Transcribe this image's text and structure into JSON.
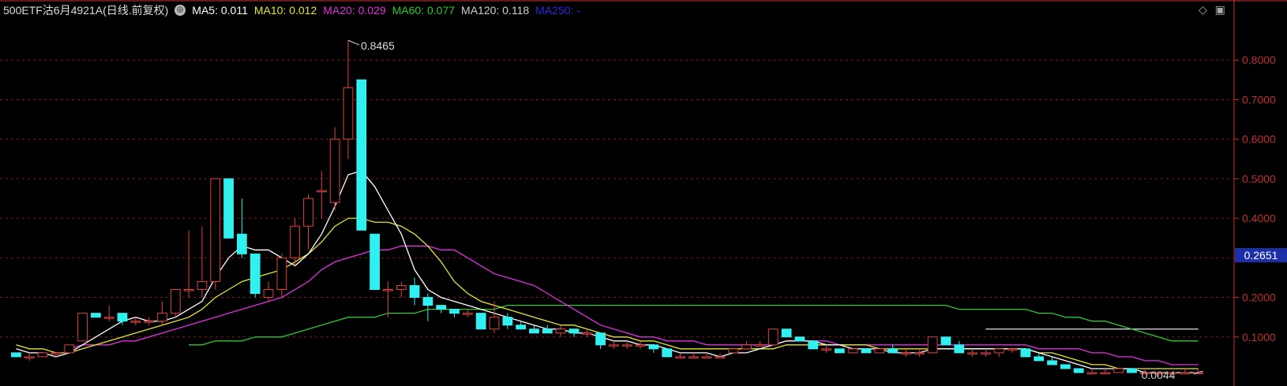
{
  "legend": {
    "title": "500ETF沽6月4921A(日线.前复权)",
    "indicators": [
      {
        "name": "MA5: 0.011",
        "color": "#ffffff"
      },
      {
        "name": "MA10: 0.012",
        "color": "#e8e82a"
      },
      {
        "name": "MA20: 0.029",
        "color": "#e030e0"
      },
      {
        "name": "MA60: 0.077",
        "color": "#2ec82e"
      },
      {
        "name": "MA120: 0.118",
        "color": "#d0d0d0"
      },
      {
        "name": "MA250: -",
        "color": "#2a2adf"
      }
    ]
  },
  "price_badge": "0.2651",
  "chart_data": {
    "type": "candlestick",
    "y_axis": {
      "min": 0,
      "max": 0.9,
      "ticks": [
        "0.8000",
        "0.7000",
        "0.6000",
        "0.5000",
        "0.4000",
        "0.3000",
        "0.2000",
        "0.1000"
      ],
      "values": [
        0.8,
        0.7,
        0.6,
        0.5,
        0.4,
        0.3,
        0.2,
        0.1
      ]
    },
    "annotations": {
      "high": "0.8465",
      "low": "0.0044"
    },
    "grid": true,
    "colors": {
      "up": "#e04040",
      "down": "#30f0f0",
      "axis": "#c03030"
    },
    "candles": [
      [
        0.06,
        0.06,
        0.05,
        0.05
      ],
      [
        0.05,
        0.06,
        0.04,
        0.05
      ],
      [
        0.05,
        0.06,
        0.05,
        0.06
      ],
      [
        0.06,
        0.06,
        0.05,
        0.06
      ],
      [
        0.06,
        0.08,
        0.06,
        0.08
      ],
      [
        0.09,
        0.16,
        0.09,
        0.16
      ],
      [
        0.16,
        0.16,
        0.15,
        0.15
      ],
      [
        0.15,
        0.18,
        0.14,
        0.15
      ],
      [
        0.16,
        0.16,
        0.13,
        0.14
      ],
      [
        0.14,
        0.15,
        0.13,
        0.14
      ],
      [
        0.14,
        0.15,
        0.13,
        0.14
      ],
      [
        0.14,
        0.19,
        0.13,
        0.16
      ],
      [
        0.16,
        0.22,
        0.15,
        0.22
      ],
      [
        0.22,
        0.37,
        0.2,
        0.22
      ],
      [
        0.22,
        0.38,
        0.2,
        0.24
      ],
      [
        0.24,
        0.5,
        0.22,
        0.5
      ],
      [
        0.5,
        0.5,
        0.35,
        0.35
      ],
      [
        0.36,
        0.45,
        0.3,
        0.31
      ],
      [
        0.31,
        0.3,
        0.2,
        0.21
      ],
      [
        0.2,
        0.24,
        0.19,
        0.22
      ],
      [
        0.22,
        0.31,
        0.2,
        0.3
      ],
      [
        0.3,
        0.4,
        0.28,
        0.38
      ],
      [
        0.38,
        0.46,
        0.32,
        0.45
      ],
      [
        0.47,
        0.52,
        0.4,
        0.47
      ],
      [
        0.44,
        0.63,
        0.42,
        0.6
      ],
      [
        0.6,
        0.85,
        0.55,
        0.73
      ],
      [
        0.75,
        0.75,
        0.37,
        0.37
      ],
      [
        0.36,
        0.36,
        0.22,
        0.22
      ],
      [
        0.22,
        0.24,
        0.15,
        0.22
      ],
      [
        0.22,
        0.24,
        0.2,
        0.23
      ],
      [
        0.23,
        0.25,
        0.18,
        0.2
      ],
      [
        0.2,
        0.21,
        0.14,
        0.18
      ],
      [
        0.18,
        0.18,
        0.16,
        0.17
      ],
      [
        0.17,
        0.17,
        0.15,
        0.16
      ],
      [
        0.16,
        0.17,
        0.15,
        0.16
      ],
      [
        0.16,
        0.16,
        0.12,
        0.12
      ],
      [
        0.12,
        0.19,
        0.11,
        0.15
      ],
      [
        0.15,
        0.16,
        0.12,
        0.13
      ],
      [
        0.13,
        0.14,
        0.12,
        0.12
      ],
      [
        0.12,
        0.13,
        0.11,
        0.11
      ],
      [
        0.12,
        0.13,
        0.11,
        0.11
      ],
      [
        0.11,
        0.13,
        0.1,
        0.12
      ],
      [
        0.12,
        0.12,
        0.1,
        0.11
      ],
      [
        0.11,
        0.12,
        0.1,
        0.11
      ],
      [
        0.11,
        0.11,
        0.07,
        0.08
      ],
      [
        0.08,
        0.09,
        0.07,
        0.08
      ],
      [
        0.08,
        0.09,
        0.07,
        0.08
      ],
      [
        0.08,
        0.09,
        0.07,
        0.08
      ],
      [
        0.08,
        0.08,
        0.06,
        0.07
      ],
      [
        0.07,
        0.07,
        0.05,
        0.05
      ],
      [
        0.05,
        0.06,
        0.05,
        0.05
      ],
      [
        0.05,
        0.06,
        0.05,
        0.05
      ],
      [
        0.05,
        0.06,
        0.05,
        0.05
      ],
      [
        0.05,
        0.06,
        0.05,
        0.05
      ],
      [
        0.06,
        0.07,
        0.06,
        0.07
      ],
      [
        0.07,
        0.09,
        0.07,
        0.08
      ],
      [
        0.08,
        0.09,
        0.08,
        0.08
      ],
      [
        0.08,
        0.12,
        0.08,
        0.12
      ],
      [
        0.12,
        0.12,
        0.1,
        0.1
      ],
      [
        0.1,
        0.1,
        0.09,
        0.09
      ],
      [
        0.09,
        0.09,
        0.07,
        0.07
      ],
      [
        0.07,
        0.08,
        0.06,
        0.07
      ],
      [
        0.07,
        0.07,
        0.06,
        0.06
      ],
      [
        0.06,
        0.07,
        0.06,
        0.07
      ],
      [
        0.07,
        0.07,
        0.06,
        0.06
      ],
      [
        0.06,
        0.07,
        0.06,
        0.07
      ],
      [
        0.07,
        0.08,
        0.06,
        0.06
      ],
      [
        0.06,
        0.07,
        0.05,
        0.06
      ],
      [
        0.06,
        0.07,
        0.05,
        0.06
      ],
      [
        0.06,
        0.1,
        0.06,
        0.1
      ],
      [
        0.1,
        0.1,
        0.08,
        0.08
      ],
      [
        0.08,
        0.09,
        0.06,
        0.06
      ],
      [
        0.06,
        0.07,
        0.05,
        0.06
      ],
      [
        0.06,
        0.07,
        0.05,
        0.06
      ],
      [
        0.06,
        0.07,
        0.05,
        0.07
      ],
      [
        0.07,
        0.07,
        0.06,
        0.07
      ],
      [
        0.07,
        0.07,
        0.05,
        0.05
      ],
      [
        0.05,
        0.06,
        0.04,
        0.04
      ],
      [
        0.04,
        0.05,
        0.03,
        0.03
      ],
      [
        0.03,
        0.03,
        0.02,
        0.02
      ],
      [
        0.02,
        0.02,
        0.01,
        0.01
      ],
      [
        0.01,
        0.02,
        0.01,
        0.01
      ],
      [
        0.01,
        0.02,
        0.01,
        0.01
      ],
      [
        0.01,
        0.02,
        0.01,
        0.02
      ],
      [
        0.02,
        0.02,
        0.01,
        0.01
      ],
      [
        0.01,
        0.02,
        0.01,
        0.01
      ],
      [
        0.01,
        0.01,
        0.0,
        0.01
      ],
      [
        0.01,
        0.01,
        0.0,
        0.01
      ],
      [
        0.01,
        0.02,
        0.01,
        0.01
      ],
      [
        0.01,
        0.02,
        0.01,
        0.01
      ]
    ],
    "ma5": [
      0.07,
      0.06,
      0.06,
      0.05,
      0.06,
      0.08,
      0.1,
      0.12,
      0.14,
      0.15,
      0.14,
      0.14,
      0.15,
      0.17,
      0.19,
      0.25,
      0.3,
      0.33,
      0.32,
      0.32,
      0.3,
      0.28,
      0.31,
      0.36,
      0.43,
      0.51,
      0.52,
      0.48,
      0.42,
      0.36,
      0.27,
      0.22,
      0.2,
      0.19,
      0.18,
      0.17,
      0.16,
      0.15,
      0.14,
      0.13,
      0.12,
      0.12,
      0.11,
      0.11,
      0.1,
      0.09,
      0.09,
      0.08,
      0.08,
      0.07,
      0.06,
      0.06,
      0.06,
      0.05,
      0.06,
      0.06,
      0.07,
      0.08,
      0.09,
      0.09,
      0.09,
      0.08,
      0.08,
      0.07,
      0.07,
      0.07,
      0.06,
      0.06,
      0.06,
      0.07,
      0.07,
      0.07,
      0.07,
      0.07,
      0.07,
      0.07,
      0.07,
      0.06,
      0.05,
      0.04,
      0.03,
      0.02,
      0.02,
      0.02,
      0.02,
      0.01,
      0.01,
      0.01,
      0.01,
      0.01
    ],
    "ma10": [
      0.08,
      0.07,
      0.07,
      0.06,
      0.06,
      0.07,
      0.08,
      0.09,
      0.1,
      0.11,
      0.12,
      0.13,
      0.14,
      0.15,
      0.17,
      0.2,
      0.22,
      0.24,
      0.25,
      0.26,
      0.27,
      0.29,
      0.31,
      0.34,
      0.38,
      0.4,
      0.4,
      0.39,
      0.39,
      0.38,
      0.36,
      0.33,
      0.29,
      0.24,
      0.21,
      0.19,
      0.18,
      0.17,
      0.16,
      0.15,
      0.14,
      0.13,
      0.13,
      0.12,
      0.11,
      0.1,
      0.1,
      0.09,
      0.09,
      0.08,
      0.07,
      0.07,
      0.07,
      0.07,
      0.07,
      0.07,
      0.07,
      0.07,
      0.08,
      0.08,
      0.08,
      0.08,
      0.08,
      0.08,
      0.08,
      0.07,
      0.07,
      0.07,
      0.07,
      0.07,
      0.07,
      0.07,
      0.07,
      0.07,
      0.07,
      0.07,
      0.07,
      0.06,
      0.06,
      0.05,
      0.04,
      0.03,
      0.03,
      0.02,
      0.02,
      0.02,
      0.02,
      0.02,
      0.02,
      0.02
    ],
    "ma20": [
      null,
      null,
      null,
      null,
      0.07,
      0.08,
      0.08,
      0.08,
      0.09,
      0.09,
      0.1,
      0.11,
      0.12,
      0.13,
      0.14,
      0.15,
      0.16,
      0.17,
      0.18,
      0.19,
      0.2,
      0.22,
      0.24,
      0.27,
      0.29,
      0.3,
      0.31,
      0.32,
      0.32,
      0.33,
      0.33,
      0.33,
      0.32,
      0.32,
      0.3,
      0.28,
      0.26,
      0.25,
      0.24,
      0.23,
      0.21,
      0.19,
      0.17,
      0.15,
      0.13,
      0.12,
      0.11,
      0.1,
      0.1,
      0.09,
      0.09,
      0.09,
      0.08,
      0.08,
      0.08,
      0.08,
      0.08,
      0.08,
      0.09,
      0.09,
      0.09,
      0.09,
      0.08,
      0.08,
      0.08,
      0.08,
      0.08,
      0.08,
      0.08,
      0.08,
      0.08,
      0.08,
      0.08,
      0.08,
      0.08,
      0.08,
      0.08,
      0.07,
      0.07,
      0.07,
      0.07,
      0.06,
      0.06,
      0.05,
      0.05,
      0.04,
      0.04,
      0.03,
      0.03,
      0.03
    ],
    "ma60": [
      null,
      null,
      null,
      null,
      null,
      null,
      null,
      null,
      null,
      null,
      null,
      null,
      null,
      0.08,
      0.08,
      0.09,
      0.09,
      0.09,
      0.1,
      0.1,
      0.1,
      0.11,
      0.12,
      0.13,
      0.14,
      0.15,
      0.15,
      0.15,
      0.16,
      0.16,
      0.16,
      0.17,
      0.17,
      0.17,
      0.17,
      0.17,
      0.17,
      0.18,
      0.18,
      0.18,
      0.18,
      0.18,
      0.18,
      0.18,
      0.18,
      0.18,
      0.18,
      0.18,
      0.18,
      0.18,
      0.18,
      0.18,
      0.18,
      0.18,
      0.18,
      0.18,
      0.18,
      0.18,
      0.18,
      0.18,
      0.18,
      0.18,
      0.18,
      0.18,
      0.18,
      0.18,
      0.18,
      0.18,
      0.18,
      0.18,
      0.18,
      0.17,
      0.17,
      0.17,
      0.17,
      0.17,
      0.17,
      0.16,
      0.16,
      0.15,
      0.15,
      0.14,
      0.14,
      0.13,
      0.12,
      0.11,
      0.1,
      0.09,
      0.09,
      0.09
    ],
    "ma120": [
      null,
      null,
      null,
      null,
      null,
      null,
      null,
      null,
      null,
      null,
      null,
      null,
      null,
      null,
      null,
      null,
      null,
      null,
      null,
      null,
      null,
      null,
      null,
      null,
      null,
      null,
      null,
      null,
      null,
      null,
      null,
      null,
      null,
      null,
      null,
      null,
      null,
      null,
      null,
      null,
      null,
      null,
      null,
      null,
      null,
      null,
      null,
      null,
      null,
      null,
      null,
      null,
      null,
      null,
      null,
      null,
      null,
      null,
      null,
      null,
      null,
      null,
      null,
      null,
      null,
      null,
      null,
      null,
      null,
      null,
      null,
      null,
      null,
      0.12,
      0.12,
      0.12,
      0.12,
      0.12,
      0.12,
      0.12,
      0.12,
      0.12,
      0.12,
      0.12,
      0.12,
      0.12,
      0.12,
      0.12,
      0.12,
      0.12
    ]
  }
}
